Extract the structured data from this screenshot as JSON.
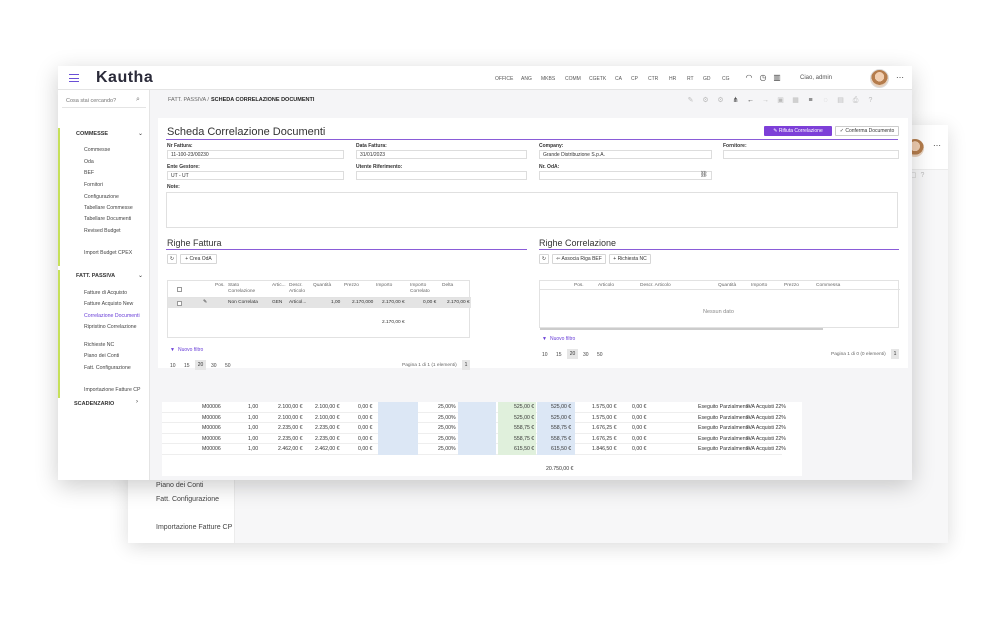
{
  "app": {
    "logo": "Kautha"
  },
  "topbar": {
    "nav": [
      "OFFICE",
      "ANG",
      "MKBS",
      "COMM",
      "CGETK",
      "CA",
      "CP",
      "CTR",
      "HR",
      "RT",
      "GD",
      "CG"
    ],
    "user_greeting": "Ciao, admin",
    "icons": [
      "gauge-icon",
      "clock-icon",
      "book-icon"
    ]
  },
  "sidebar": {
    "search_placeholder": "Cosa stai cercando?",
    "groups": [
      {
        "label": "COMMESSE",
        "items": [
          "Commesse",
          "Oda",
          "BEF",
          "Fornitori",
          "Configurazione",
          "Tabellare Commesse",
          "Tabellare Documenti",
          "Revised Budget",
          "Import Budget CPEX"
        ]
      },
      {
        "label": "FATT. PASSIVA",
        "items": [
          "Fatture di Acquisto",
          "Fatture Acquisto New",
          "Correlazione Documenti",
          "Ripristino Correlazione",
          "Richieste NC",
          "Piano dei Conti",
          "Fatt. Configurazione",
          "Importazione Fatture CP"
        ]
      },
      {
        "label": "SCADENZARIO",
        "items": []
      }
    ],
    "active_item": "Correlazione Documenti"
  },
  "breadcrumb": {
    "parent": "FATT. PASSIVA /",
    "current": "SCHEDA CORRELAZIONE DOCUMENTI"
  },
  "page": {
    "title": "Scheda Correlazione Documenti",
    "reject_button": "Rifiuta Correlazione",
    "confirm_button": "Conferma Documento",
    "fields": {
      "nr_fattura_label": "Nr Fattura:",
      "nr_fattura": "11-100-23/00230",
      "data_fattura_label": "Data Fattura:",
      "data_fattura": "31/01/2023",
      "company_label": "Company:",
      "company": "Grande Distribuzione S.p.A.",
      "fornitore_label": "Fornitore:",
      "fornitore": "",
      "ente_label": "Ente Gestore:",
      "ente": "UT - UT",
      "utente_label": "Utente Riferimento:",
      "utente": "",
      "oda_label": "Nr. OdA:",
      "oda": "",
      "note_label": "Note:"
    }
  },
  "righe_fattura": {
    "title": "Righe Fattura",
    "create_button": "Crea OdA",
    "columns": [
      "Pos.",
      "Stato Correlazione",
      "Artic...",
      "Descr. Articolo",
      "Quantità",
      "Prezzo",
      "Importo",
      "Importo Correlato",
      "Delta"
    ],
    "row": {
      "stato": "Non Correlata",
      "articolo": "GEN",
      "descrizione": "Articol...",
      "quantita": "1,00",
      "prezzo": "2.170,000",
      "importo": "2.170,00 €",
      "importo_correlato": "0,00 €",
      "delta": "2.170,00 €"
    },
    "total": "2.170,00 €",
    "filter_label": "Nuovo filtro",
    "page_sizes": [
      "10",
      "15",
      "20",
      "30",
      "50"
    ],
    "active_page_size": "20",
    "pager_info": "Pagina 1 di 1 (1 elementi)",
    "page_number": "1"
  },
  "righe_correlazione": {
    "title": "Righe Correlazione",
    "associa_button": "Associa Riga BEF",
    "richiesta_button": "Richiesta NC",
    "columns": [
      "Pos.",
      "Articolo",
      "Descr. Articolo",
      "Quantità",
      "Importo",
      "Prezzo",
      "Commessa"
    ],
    "empty_text": "Nessun dato",
    "filter_label": "Nuovo filtro",
    "page_sizes": [
      "10",
      "15",
      "20",
      "30",
      "50"
    ],
    "active_page_size": "20",
    "pager_info": "Pagina 1 di 0 (0 elementi)",
    "page_number": "1"
  },
  "back_window": {
    "sidebar_items": [
      "Piano dei Conti",
      "Fatt. Configurazione",
      "Importazione Fatture CP"
    ],
    "rows": [
      [
        "M00006",
        "1,00",
        "2.100,00 €",
        "2.100,00 €",
        "0,00 €",
        "25,00%",
        "525,00 €",
        "525,00 €",
        "1.575,00 €",
        "0,00 €",
        "Eseguito Parzialmente",
        "IVA Acquisti 22%"
      ],
      [
        "M00006",
        "1,00",
        "2.100,00 €",
        "2.100,00 €",
        "0,00 €",
        "25,00%",
        "525,00 €",
        "525,00 €",
        "1.575,00 €",
        "0,00 €",
        "Eseguito Parzialmente",
        "IVA Acquisti 22%"
      ],
      [
        "M00006",
        "1,00",
        "2.235,00 €",
        "2.235,00 €",
        "0,00 €",
        "25,00%",
        "558,75 €",
        "558,75 €",
        "1.676,25 €",
        "0,00 €",
        "Eseguito Parzialmente",
        "IVA Acquisti 22%"
      ],
      [
        "M00006",
        "1,00",
        "2.235,00 €",
        "2.235,00 €",
        "0,00 €",
        "25,00%",
        "558,75 €",
        "558,75 €",
        "1.676,25 €",
        "0,00 €",
        "Eseguito Parzialmente",
        "IVA Acquisti 22%"
      ],
      [
        "M00006",
        "1,00",
        "2.462,00 €",
        "2.462,00 €",
        "0,00 €",
        "25,00%",
        "615,50 €",
        "615,50 €",
        "1.846,50 €",
        "0,00 €",
        "Eseguito Parzialmente",
        "IVA Acquisti 22%"
      ]
    ],
    "total": "20.750,00 €"
  },
  "colors": {
    "accent": "#7d3fd8",
    "sidebar_marker": "#c6e05a"
  }
}
